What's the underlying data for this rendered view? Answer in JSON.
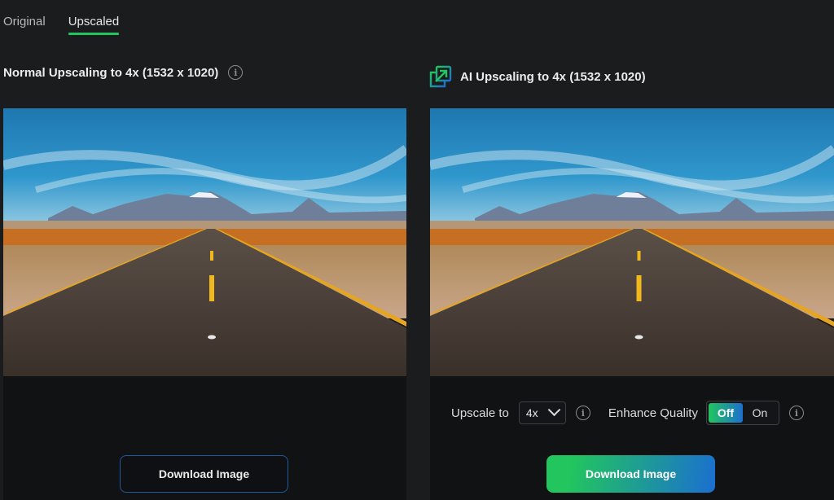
{
  "tabs": [
    {
      "label": "Original",
      "active": false
    },
    {
      "label": "Upscaled",
      "active": true
    }
  ],
  "left_panel": {
    "title": "Normal Upscaling to 4x (1532 x 1020)",
    "info_icon": "info-icon",
    "image_alt": "Desert highway leading to mountains under blue sky",
    "download_label": "Download Image"
  },
  "right_panel": {
    "title": "AI Upscaling to 4x (1532 x 1020)",
    "title_icon": "ai-upscale-icon",
    "image_alt": "Desert highway leading to mountains under blue sky (AI upscaled)",
    "upscale_label": "Upscale to",
    "upscale_value": "4x",
    "enhance_label": "Enhance Quality",
    "enhance_options": [
      "Off",
      "On"
    ],
    "enhance_selected": "Off",
    "download_label": "Download Image"
  },
  "colors": {
    "accent_green": "#22c55e",
    "accent_blue": "#1b6fd0",
    "background": "#1b1c1e",
    "panel": "#111214"
  }
}
